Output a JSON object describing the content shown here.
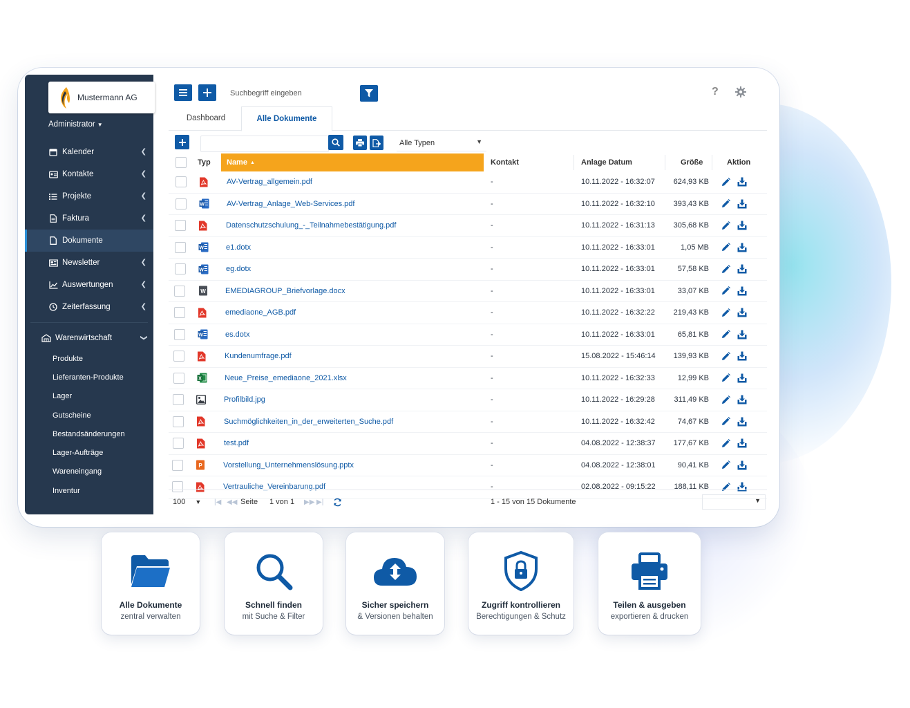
{
  "brand": {
    "name": "Mustermann AG"
  },
  "user": {
    "role": "Administrator"
  },
  "sidebar": {
    "items": [
      {
        "label": "Kalender",
        "icon": "calendar-icon"
      },
      {
        "label": "Kontakte",
        "icon": "address-card-icon"
      },
      {
        "label": "Projekte",
        "icon": "list-icon"
      },
      {
        "label": "Faktura",
        "icon": "invoice-icon"
      },
      {
        "label": "Dokumente",
        "icon": "document-icon",
        "active": true
      },
      {
        "label": "Newsletter",
        "icon": "newsletter-icon"
      },
      {
        "label": "Auswertungen",
        "icon": "chart-icon"
      },
      {
        "label": "Zeiterfassung",
        "icon": "clock-icon"
      }
    ],
    "group": {
      "label": "Warenwirtschaft",
      "icon": "warehouse-icon"
    },
    "subitems": [
      "Produkte",
      "Lieferanten-Produkte",
      "Lager",
      "Gutscheine",
      "Bestandsänderungen",
      "Lager-Aufträge",
      "Wareneingang",
      "Inventur"
    ]
  },
  "toolbar": {
    "search_placeholder": "Suchbegriff eingeben",
    "help": "?"
  },
  "tabs": [
    "Dashboard",
    "Alle Dokumente"
  ],
  "filter": {
    "type_select": "Alle Typen"
  },
  "table": {
    "headers": {
      "type": "Typ",
      "name": "Name",
      "sort_arrow": "▲",
      "contact": "Kontakt",
      "date": "Anlage Datum",
      "size": "Größe",
      "action": "Aktion"
    },
    "rows": [
      {
        "type": "pdf",
        "name": "AV-Vertrag_allgemein.pdf",
        "contact": "-",
        "date": "10.11.2022 - 16:32:07",
        "size": "624,93 KB"
      },
      {
        "type": "word",
        "name": "AV-Vertrag_Anlage_Web-Services.pdf",
        "contact": "-",
        "date": "10.11.2022 - 16:32:10",
        "size": "393,43 KB"
      },
      {
        "type": "pdf",
        "name": "Datenschutzschulung_-_Teilnahmebestätigung.pdf",
        "contact": "-",
        "date": "10.11.2022 - 16:31:13",
        "size": "305,68 KB"
      },
      {
        "type": "word",
        "name": "e1.dotx",
        "contact": "-",
        "date": "10.11.2022 - 16:33:01",
        "size": "1,05 MB"
      },
      {
        "type": "word",
        "name": "eg.dotx",
        "contact": "-",
        "date": "10.11.2022 - 16:33:01",
        "size": "57,58 KB"
      },
      {
        "type": "word-dark",
        "name": "EMEDIAGROUP_Briefvorlage.docx",
        "contact": "-",
        "date": "10.11.2022 - 16:33:01",
        "size": "33,07 KB"
      },
      {
        "type": "pdf",
        "name": "emediaone_AGB.pdf",
        "contact": "-",
        "date": "10.11.2022 - 16:32:22",
        "size": "219,43 KB"
      },
      {
        "type": "word",
        "name": "es.dotx",
        "contact": "-",
        "date": "10.11.2022 - 16:33:01",
        "size": "65,81 KB"
      },
      {
        "type": "pdf",
        "name": "Kundenumfrage.pdf",
        "contact": "-",
        "date": "15.08.2022 - 15:46:14",
        "size": "139,93 KB"
      },
      {
        "type": "excel",
        "name": "Neue_Preise_emediaone_2021.xlsx",
        "contact": "-",
        "date": "10.11.2022 - 16:32:33",
        "size": "12,99 KB"
      },
      {
        "type": "image",
        "name": "Profilbild.jpg",
        "contact": "-",
        "date": "10.11.2022 - 16:29:28",
        "size": "311,49 KB"
      },
      {
        "type": "pdf",
        "name": "Suchmöglichkeiten_in_der_erweiterten_Suche.pdf",
        "contact": "-",
        "date": "10.11.2022 - 16:32:42",
        "size": "74,67 KB"
      },
      {
        "type": "pdf",
        "name": "test.pdf",
        "contact": "-",
        "date": "04.08.2022 - 12:38:37",
        "size": "177,67 KB"
      },
      {
        "type": "powerpoint",
        "name": "Vorstellung_Unternehmenslösung.pptx",
        "contact": "-",
        "date": "04.08.2022 - 12:38:01",
        "size": "90,41 KB"
      },
      {
        "type": "pdf",
        "name": "Vertrauliche_Vereinbarung.pdf",
        "contact": "-",
        "date": "02.08.2022 - 09:15:22",
        "size": "188,11 KB"
      }
    ]
  },
  "pager": {
    "page_size": "100",
    "page_label": "Seite",
    "page_value": "1 von 1",
    "summary": "1 - 15 von 15 Dokumente"
  },
  "features": [
    {
      "title": "Alle Dokumente",
      "subtitle": "zentral verwalten",
      "icon": "folder-icon"
    },
    {
      "title": "Schnell finden",
      "subtitle": "mit Suche & Filter",
      "icon": "search-icon"
    },
    {
      "title": "Sicher speichern",
      "subtitle": "& Versionen behalten",
      "icon": "cloud-icon"
    },
    {
      "title": "Zugriff kontrollieren",
      "subtitle": "Berechtigungen & Schutz",
      "icon": "shield-lock-icon"
    },
    {
      "title": "Teilen & ausgeben",
      "subtitle": "exportieren & drucken",
      "icon": "printer-icon"
    }
  ],
  "colors": {
    "sidebar": "#26384e",
    "accent": "#0f5aa6",
    "sort_header": "#f5a41c",
    "pdf": "#e2382a",
    "word": "#2b6cc4",
    "excel": "#1e8a44",
    "powerpoint": "#e8671e"
  }
}
